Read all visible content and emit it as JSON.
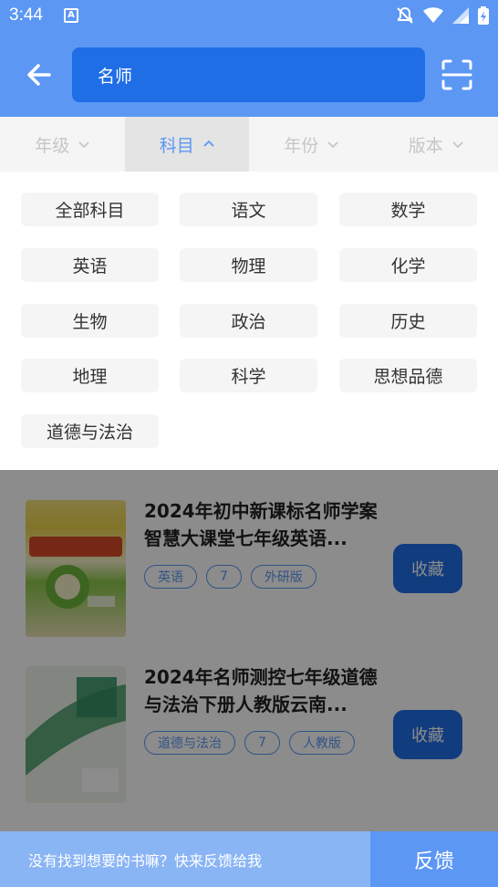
{
  "status_bar": {
    "time": "3:44",
    "a_badge": "A"
  },
  "search": {
    "value": "名师"
  },
  "filters": [
    {
      "label": "年级",
      "active": false
    },
    {
      "label": "科目",
      "active": true
    },
    {
      "label": "年份",
      "active": false
    },
    {
      "label": "版本",
      "active": false
    }
  ],
  "subjects": [
    "全部科目",
    "语文",
    "数学",
    "英语",
    "物理",
    "化学",
    "生物",
    "政治",
    "历史",
    "地理",
    "科学",
    "思想品德",
    "道德与法治"
  ],
  "books": [
    {
      "title": "2024年初中新课标名师学案智慧大课堂七年级英语...",
      "tags": [
        "英语",
        "7",
        "外研版"
      ],
      "favorite_label": "收藏"
    },
    {
      "title": "2024年名师测控七年级道德与法治下册人教版云南...",
      "tags": [
        "道德与法治",
        "7",
        "人教版"
      ],
      "favorite_label": "收藏"
    }
  ],
  "feedback": {
    "prompt": "没有找到想要的书嘛？快来反馈给我",
    "button_label": "反馈"
  },
  "colors": {
    "primary": "#5c97f4",
    "primary_dark": "#1f6ee6",
    "chip_bg": "#f5f5f5"
  }
}
